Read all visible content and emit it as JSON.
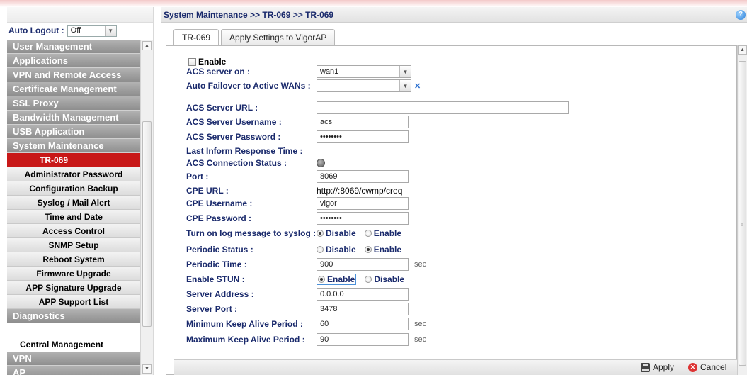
{
  "breadcrumb": "System Maintenance >> TR-069 >> TR-069",
  "help_icon": "?",
  "auto_logout": {
    "label": "Auto Logout :",
    "value": "Off"
  },
  "menu": [
    {
      "label": "User Management",
      "kind": "cat"
    },
    {
      "label": "Applications",
      "kind": "cat"
    },
    {
      "label": "VPN and Remote Access",
      "kind": "cat"
    },
    {
      "label": "Certificate Management",
      "kind": "cat"
    },
    {
      "label": "SSL Proxy",
      "kind": "cat"
    },
    {
      "label": "Bandwidth Management",
      "kind": "cat"
    },
    {
      "label": "USB Application",
      "kind": "cat"
    },
    {
      "label": "System Maintenance",
      "kind": "cat"
    },
    {
      "label": "TR-069",
      "kind": "active"
    },
    {
      "label": "Administrator Password",
      "kind": "sub"
    },
    {
      "label": "Configuration Backup",
      "kind": "sub"
    },
    {
      "label": "Syslog / Mail Alert",
      "kind": "sub"
    },
    {
      "label": "Time and Date",
      "kind": "sub"
    },
    {
      "label": "Access Control",
      "kind": "sub"
    },
    {
      "label": "SNMP Setup",
      "kind": "sub"
    },
    {
      "label": "Reboot System",
      "kind": "sub"
    },
    {
      "label": "Firmware Upgrade",
      "kind": "sub"
    },
    {
      "label": "APP Signature Upgrade",
      "kind": "sub"
    },
    {
      "label": "APP Support List",
      "kind": "sub"
    },
    {
      "label": "Diagnostics",
      "kind": "cat"
    },
    {
      "label": "",
      "kind": "gap"
    },
    {
      "label": "Central Management",
      "kind": "plain"
    },
    {
      "label": "VPN",
      "kind": "cat"
    },
    {
      "label": "AP",
      "kind": "cat"
    }
  ],
  "tabs": [
    "TR-069",
    "Apply Settings to VigorAP"
  ],
  "enable_label": "Enable",
  "form": {
    "acs_server_on": {
      "label": "ACS server on :",
      "value": "wan1"
    },
    "auto_failover": {
      "label": "Auto Failover to Active WANs :",
      "value": "",
      "clear": "✕"
    },
    "acs_url": {
      "label": "ACS Server URL :",
      "value": ""
    },
    "acs_username": {
      "label": "ACS Server Username :",
      "value": "acs"
    },
    "acs_password": {
      "label": "ACS Server Password :",
      "value": "••••••••"
    },
    "last_inform": {
      "label": "Last Inform Response Time :"
    },
    "acs_status": {
      "label": "ACS Connection Status :"
    },
    "port": {
      "label": "Port :",
      "value": "8069"
    },
    "cpe_url": {
      "label": "CPE URL :",
      "value": "http://:8069/cwmp/creq"
    },
    "cpe_username": {
      "label": "CPE Username :",
      "value": "vigor"
    },
    "cpe_password": {
      "label": "CPE Password :",
      "value": "••••••••"
    },
    "log_syslog": {
      "label": "Turn on log message to syslog :",
      "opt1": "Disable",
      "opt2": "Enable"
    },
    "periodic_status": {
      "label": "Periodic Status :",
      "opt1": "Disable",
      "opt2": "Enable"
    },
    "periodic_time": {
      "label": "Periodic Time :",
      "value": "900",
      "unit": "sec"
    },
    "enable_stun": {
      "label": "Enable STUN :",
      "opt1": "Enable",
      "opt2": "Disable"
    },
    "server_address": {
      "label": "Server Address :",
      "value": "0.0.0.0"
    },
    "server_port": {
      "label": "Server Port :",
      "value": "3478"
    },
    "min_keepalive": {
      "label": "Minimum Keep Alive Period :",
      "value": "60",
      "unit": "sec"
    },
    "max_keepalive": {
      "label": "Maximum Keep Alive Period :",
      "value": "90",
      "unit": "sec"
    }
  },
  "buttons": {
    "apply": "Apply",
    "cancel": "Cancel"
  }
}
